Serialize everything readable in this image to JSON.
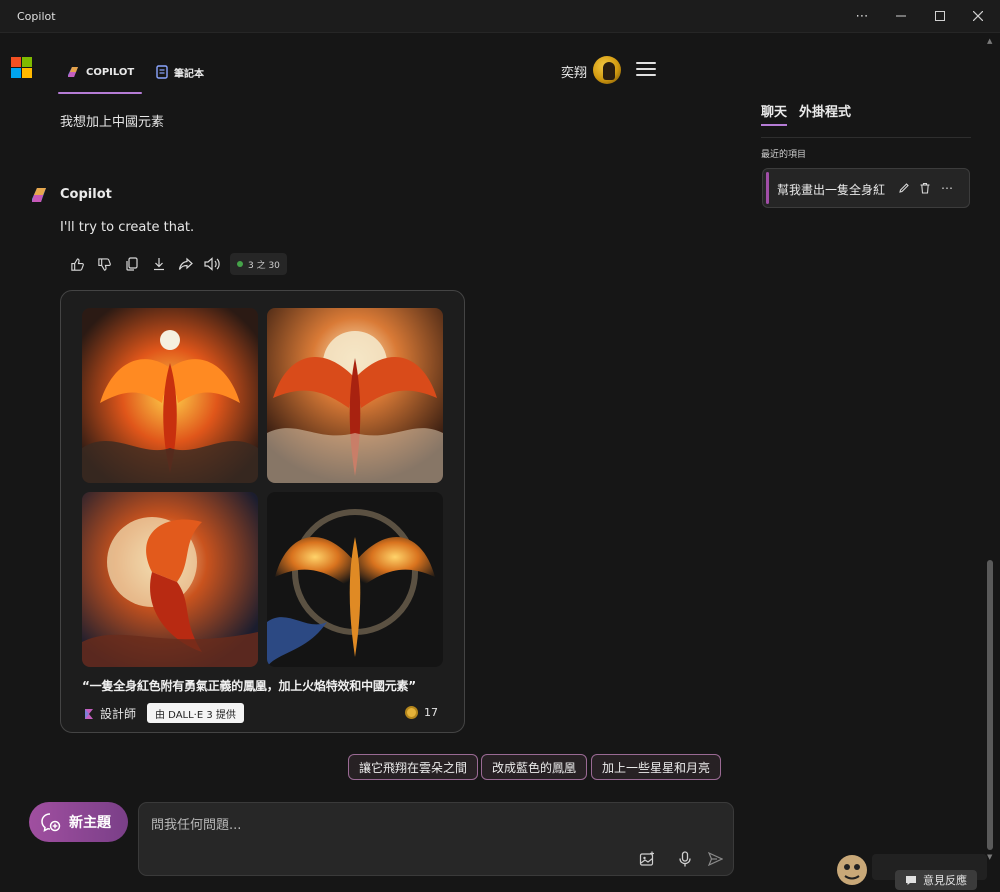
{
  "window": {
    "title": "Copilot",
    "more_label": "⋯"
  },
  "header": {
    "tabs": [
      {
        "label": "COPILOT",
        "icon": "copilot-icon",
        "active": true
      },
      {
        "label": "筆記本",
        "icon": "notebook-icon",
        "active": false
      }
    ],
    "user_name": "奕翔"
  },
  "chat": {
    "user_message": "我想加上中國元素",
    "bot_name": "Copilot",
    "bot_message": "I'll try to create that.",
    "response_count": "3 之 30",
    "image_card": {
      "images": [
        "phoenix-1",
        "phoenix-2",
        "phoenix-3",
        "phoenix-4"
      ],
      "caption": "“一隻全身紅色附有勇氣正義的鳳凰，加上火焰特效和中國元素”",
      "designer_label": "設計師",
      "provider_badge": "由 DALL·E 3 提供",
      "boost_count": "17"
    },
    "suggestions": [
      "讓它飛翔在雲朵之間",
      "改成藍色的鳳凰",
      "加上一些星星和月亮"
    ]
  },
  "composer": {
    "new_topic_label": "新主題",
    "placeholder": "問我任何問題..."
  },
  "sidebar": {
    "tabs": [
      {
        "label": "聊天",
        "active": true
      },
      {
        "label": "外掛程式",
        "active": false
      }
    ],
    "recent_title": "最近的項目",
    "recent_items": [
      {
        "label": "幫我畫出一隻全身紅"
      }
    ],
    "more_label": "⋯"
  },
  "feedback_label": "意見反應",
  "colors": {
    "accent": "#b57cd6",
    "new_topic": "#a04fa0",
    "background": "#161616"
  }
}
